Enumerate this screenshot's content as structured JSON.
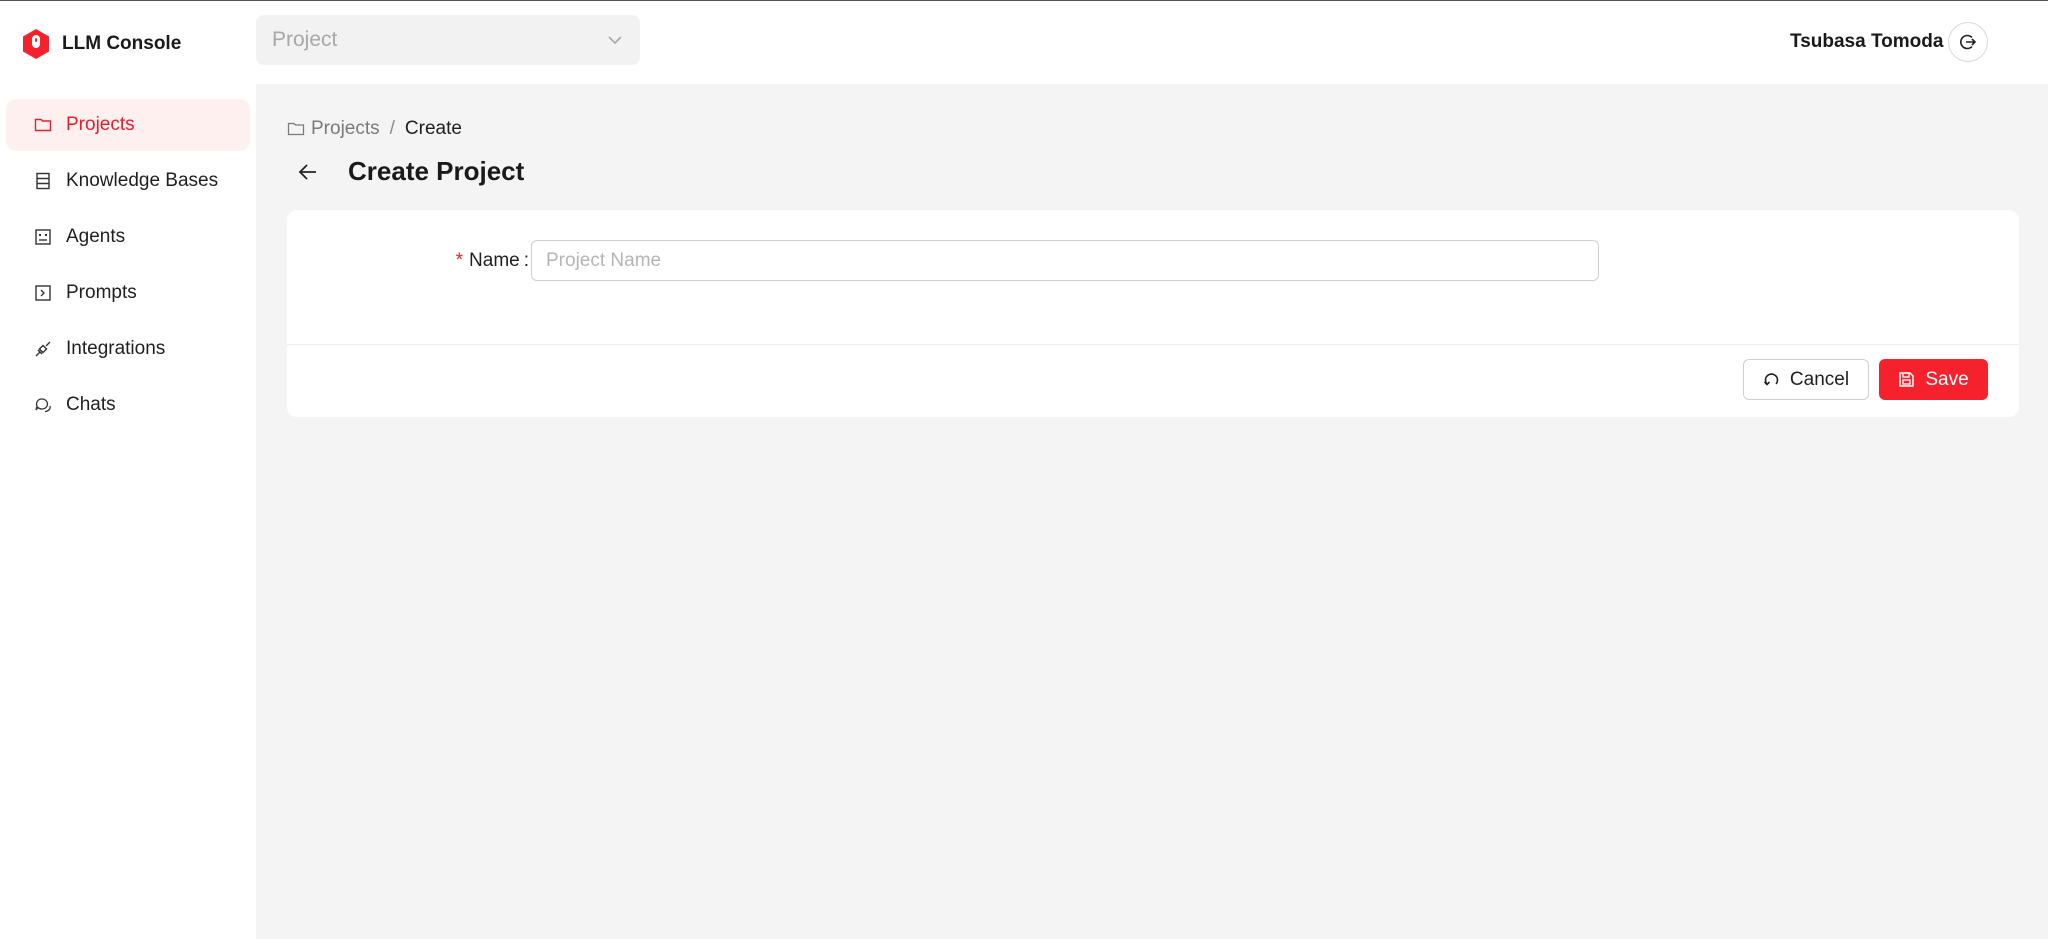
{
  "app": {
    "title": "LLM Console",
    "brand_color": "#f5222d"
  },
  "header": {
    "project_select": {
      "placeholder": "Project",
      "icon": "chevron-down-icon"
    },
    "user_name": "Tsubasa Tomoda",
    "logout_icon": "logout-icon"
  },
  "sidebar": {
    "items": [
      {
        "label": "Projects",
        "icon": "folder-icon",
        "active": true
      },
      {
        "label": "Knowledge Bases",
        "icon": "database-icon",
        "active": false
      },
      {
        "label": "Agents",
        "icon": "robot-icon",
        "active": false
      },
      {
        "label": "Prompts",
        "icon": "code-icon",
        "active": false
      },
      {
        "label": "Integrations",
        "icon": "api-icon",
        "active": false
      },
      {
        "label": "Chats",
        "icon": "chat-icon",
        "active": false
      }
    ]
  },
  "main": {
    "breadcrumb": {
      "parent": "Projects",
      "separator": "/",
      "current": "Create"
    },
    "title": "Create Project",
    "form": {
      "name_label": "Name",
      "name_colon": ":",
      "required_mark": "*",
      "name_placeholder": "Project Name",
      "name_value": ""
    },
    "actions": {
      "cancel_label": "Cancel",
      "save_label": "Save"
    }
  }
}
